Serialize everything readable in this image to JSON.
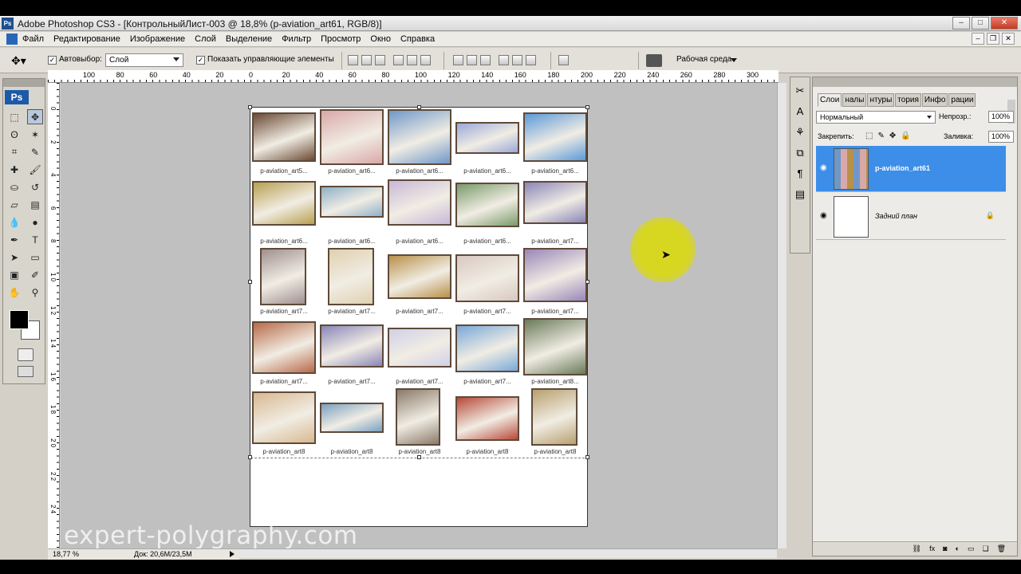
{
  "app": {
    "title": "Adobe Photoshop CS3 - [КонтрольныйЛист-003 @ 18,8% (p-aviation_art61, RGB/8)]",
    "logo": "Ps"
  },
  "window_controls": {
    "minimize": "–",
    "maximize": "□",
    "close": "✕"
  },
  "menu": {
    "items": [
      "Файл",
      "Редактирование",
      "Изображение",
      "Слой",
      "Выделение",
      "Фильтр",
      "Просмотр",
      "Окно",
      "Справка"
    ],
    "doc_controls": {
      "minimize": "–",
      "restore": "❐",
      "close": "✕"
    }
  },
  "options": {
    "autoselect_label": "Автовыбор:",
    "autoselect_value": "Слой",
    "show_controls_label": "Показать управляющие элементы",
    "workspace_label": "Рабочая среда"
  },
  "toolbox": {
    "logo": "Ps"
  },
  "rulers": {
    "h_labels": [
      "100",
      "80",
      "60",
      "40",
      "20",
      "0",
      "20",
      "40",
      "60",
      "80",
      "100",
      "120",
      "140",
      "160",
      "180",
      "200",
      "220",
      "240",
      "260",
      "280",
      "300"
    ],
    "v_labels": [
      "0",
      "2",
      "4",
      "6",
      "8",
      "1 0",
      "1 2",
      "1 4",
      "1 6",
      "1 8",
      "2 0",
      "2 2",
      "2 4"
    ]
  },
  "thumbnails": [
    [
      "p-aviation_art5...",
      "p-aviation_art6...",
      "p-aviation_art6...",
      "p-aviation_art6...",
      "p-aviation_art6..."
    ],
    [
      "p-aviation_art6...",
      "p-aviation_art6...",
      "p-aviation_art6...",
      "p-aviation_art6...",
      "p-aviation_art7..."
    ],
    [
      "p-aviation_art7...",
      "p-aviation_art7...",
      "p-aviation_art7...",
      "p-aviation_art7...",
      "p-aviation_art7..."
    ],
    [
      "p-aviation_art7...",
      "p-aviation_art7...",
      "p-aviation_art7...",
      "p-aviation_art7...",
      "p-aviation_art8..."
    ],
    [
      "p-aviation_art8",
      "p-aviation_art8",
      "p-aviation_art8",
      "p-aviation_art8",
      "p-aviation_art8"
    ]
  ],
  "thumb_colors": [
    [
      "#6b4a34",
      "#d9a8a8",
      "#6f98c8",
      "#9aa9d8",
      "#5b9ad8"
    ],
    [
      "#b8a050",
      "#8eb0c8",
      "#c8b8d8",
      "#7a9a6a",
      "#8a86b8"
    ],
    [
      "#a09090",
      "#e0d0b0",
      "#b8904a",
      "#d8c8c0",
      "#9a86b8"
    ],
    [
      "#b86a4a",
      "#8a86b8",
      "#d0d0e8",
      "#7aa8d8",
      "#6a7a5a"
    ],
    [
      "#d8b890",
      "#7aa0c0",
      "#8a7a6a",
      "#b84a3a",
      "#b8a070"
    ]
  ],
  "watermark": "expert-polygraphy.com",
  "status": {
    "zoom": "18,77 %",
    "doc": "Док: 20,6M/23,5M"
  },
  "layers_panel": {
    "tabs": [
      "Слои",
      "налы",
      "нтуры",
      "тория",
      "Инфо",
      "рации"
    ],
    "blend_mode": "Нормальный",
    "opacity_label": "Непрозр.:",
    "opacity_value": "100%",
    "lock_label": "Закрепить:",
    "fill_label": "Заливка:",
    "fill_value": "100%",
    "layers": [
      {
        "name": "p-aviation_art61",
        "selected": true
      },
      {
        "name": "Задний план",
        "selected": false
      }
    ]
  }
}
